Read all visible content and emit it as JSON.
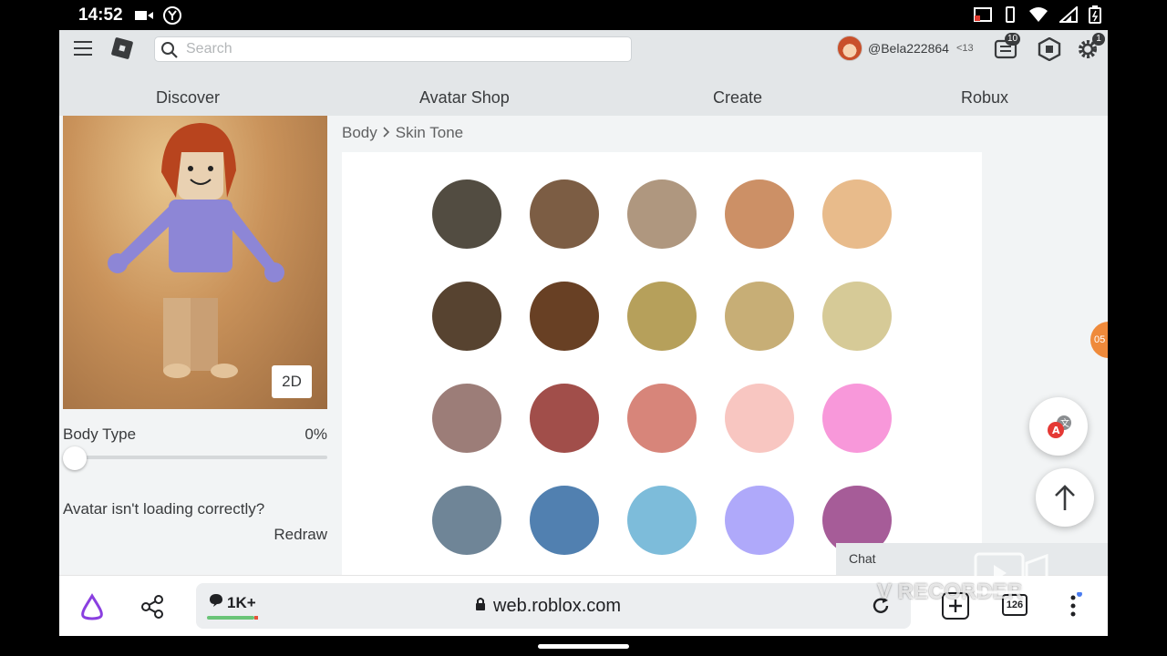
{
  "status_bar": {
    "time": "14:52"
  },
  "header": {
    "search_placeholder": "Search",
    "username": "@Bela222864",
    "age_badge": "<13",
    "notifications_count": "10",
    "settings_badge": "1",
    "tabs": [
      "Discover",
      "Avatar Shop",
      "Create",
      "Robux"
    ]
  },
  "avatar_panel": {
    "view_toggle": "2D",
    "body_type_label": "Body Type",
    "body_type_value": "0%",
    "body_type_fraction": 0,
    "loading_message": "Avatar isn't loading correctly?",
    "redraw_label": "Redraw"
  },
  "breadcrumb": {
    "parent": "Body",
    "current": "Skin Tone"
  },
  "skin_tones": [
    [
      "#524c41",
      "#7c5d44",
      "#af977f",
      "#cc9066",
      "#e8bb8b"
    ],
    [
      "#574330",
      "#684024",
      "#b6a05b",
      "#c7ae76",
      "#d6ca97"
    ],
    [
      "#9c7d78",
      "#a14e4a",
      "#d7857a",
      "#f8c6c1",
      "#f898da"
    ],
    [
      "#6f8597",
      "#5180b0",
      "#7dbcda",
      "#afa9fa",
      "#a65c98"
    ]
  ],
  "floating": {
    "edge_bubble": "05",
    "chat_label": "Chat"
  },
  "browser": {
    "comment_count": "1K+",
    "url": "web.roblox.com",
    "tab_count": "126"
  },
  "watermark": "V RECORDER"
}
